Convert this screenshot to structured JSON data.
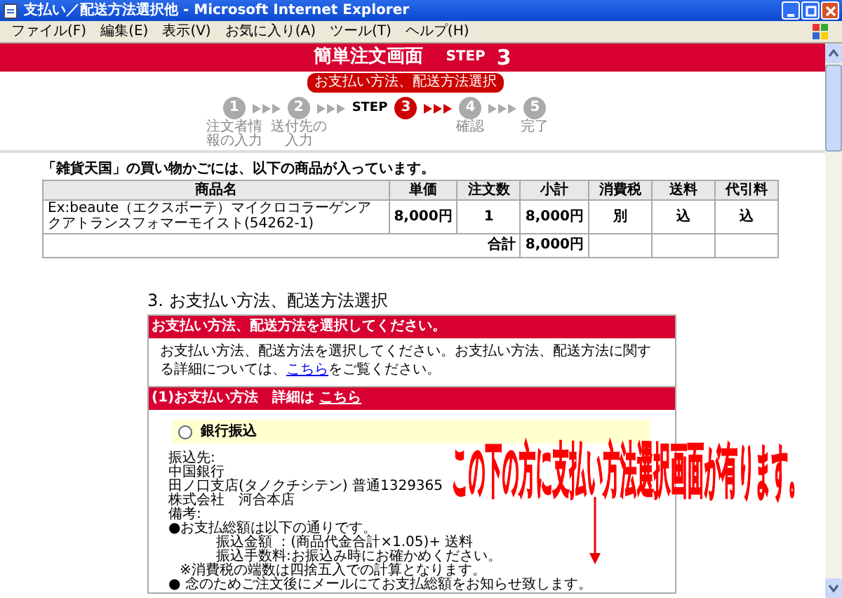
{
  "window": {
    "title": "支払い／配送方法選択他 - Microsoft Internet Explorer"
  },
  "menu": [
    "ファイル(F)",
    "編集(E)",
    "表示(V)",
    "お気に入り(A)",
    "ツール(T)",
    "ヘルプ(H)"
  ],
  "banner": {
    "title": "簡単注文画面",
    "step_label": "STEP",
    "step_number": "3"
  },
  "progress": {
    "current_label": "お支払い方法、配送方法選択",
    "step_word": "STEP",
    "steps": [
      {
        "number": "1",
        "label": "注文者情報の入力",
        "selected": false
      },
      {
        "number": "2",
        "label": "送付先の入力",
        "selected": false
      },
      {
        "number": "3",
        "selected": true
      },
      {
        "number": "4",
        "label": "確認",
        "selected": false
      },
      {
        "number": "5",
        "label": "完了",
        "selected": false
      }
    ]
  },
  "cart": {
    "intro": "「雑貨天国」の買い物かごには、以下の商品が入っています。",
    "columns": [
      "商品名",
      "単価",
      "注文数",
      "小計",
      "消費税",
      "送料",
      "代引料"
    ],
    "rows": [
      [
        "Ex:beaute（エクスボーテ）マイクロコラーゲンアクアトランスフォマーモイスト(54262-1)",
        "8,000円",
        "1",
        "8,000円",
        "別",
        "込",
        "込"
      ]
    ],
    "total_label": "合計",
    "total_value": "8,000円"
  },
  "section": {
    "heading": "3. お支払い方法、配送方法選択",
    "panel_header": "お支払い方法、配送方法を選択してください。",
    "panel_text": "お支払い方法、配送方法を選択してください。お支払い方法、配送方法に関する詳細については、",
    "panel_link": "こちら",
    "panel_text_after": "をご覧ください。",
    "sub_header": "(1)お支払い方法　詳細は",
    "sub_link": "こちら",
    "option": {
      "label": "銀行振込",
      "selected": false
    },
    "details": [
      {
        "kind": "plain",
        "text": "振込先:"
      },
      {
        "kind": "plain",
        "text": "中国銀行"
      },
      {
        "kind": "plain",
        "text": "田ノ口支店(タノクチシテン) 普通1329365"
      },
      {
        "kind": "plain",
        "text": "株式会社　河合本店"
      },
      {
        "kind": "plain",
        "text": "備考:"
      },
      {
        "kind": "plain",
        "text": "●お支払総額は以下の通りです。"
      },
      {
        "kind": "sub",
        "text": "振込金額 ：(商品代金合計×1.05)+ 送料"
      },
      {
        "kind": "sub",
        "text": "振込手数料:お振込み時にお確かめください。"
      },
      {
        "kind": "note",
        "text": "※消費税の端数は四捨五入での計算となります。"
      },
      {
        "kind": "plain",
        "text": "● 念のためご注文後にメールにてお支払総額をお知らせ致します。"
      }
    ]
  },
  "annotation": "この下の方に支払い方法選択画面が有ります。"
}
